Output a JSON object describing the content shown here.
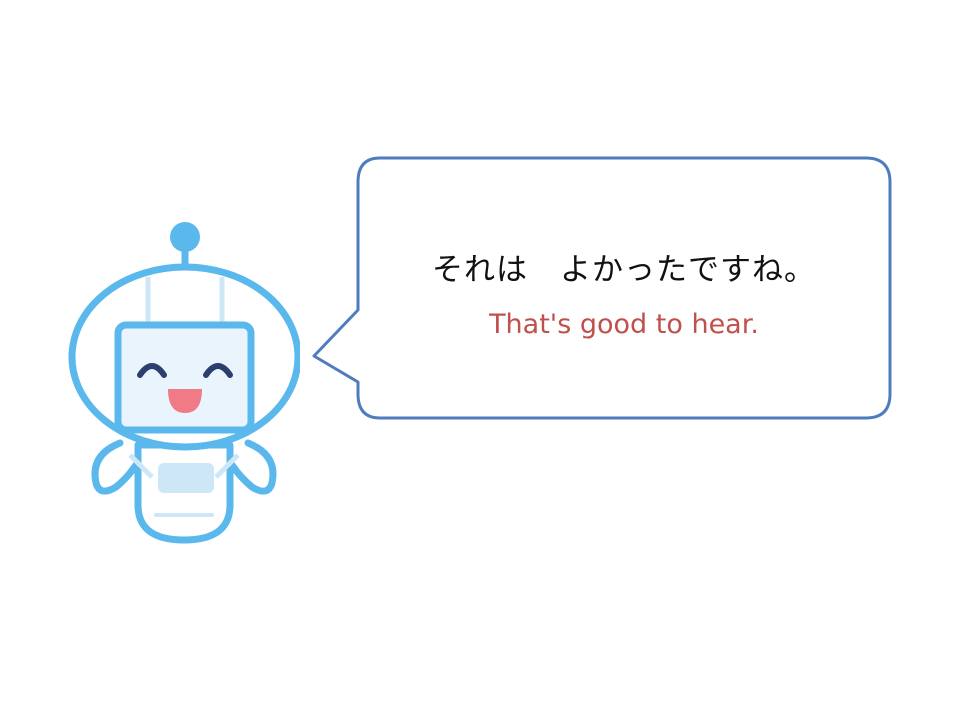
{
  "speech_bubble": {
    "japanese_text": "それは　よかったですね。",
    "english_text": "That's good to hear."
  },
  "colors": {
    "bubble_border": "#4f7bbf",
    "english_text": "#c0504d",
    "robot_outline": "#5bb8ec",
    "robot_fill": "#e9f4fc",
    "robot_eyes": "#2a3f6d",
    "robot_mouth": "#f07a86"
  },
  "icons": {
    "character": "robot-character-icon"
  }
}
